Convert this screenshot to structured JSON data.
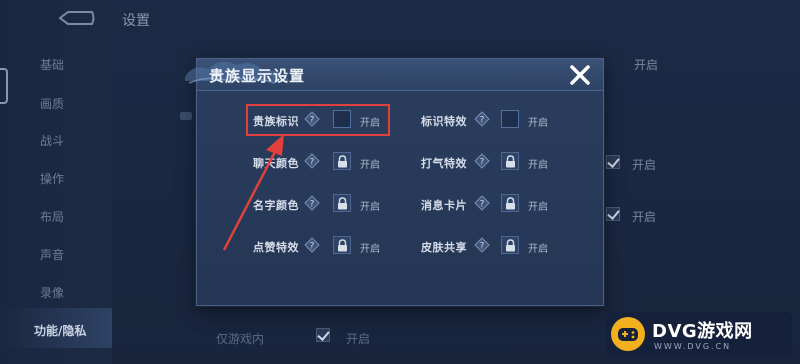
{
  "page": {
    "title": "设置"
  },
  "sidebar": {
    "items": [
      {
        "label": "基础"
      },
      {
        "label": "画质"
      },
      {
        "label": "战斗"
      },
      {
        "label": "操作"
      },
      {
        "label": "布局"
      },
      {
        "label": "声音"
      },
      {
        "label": "录像"
      },
      {
        "label": "功能/隐私"
      }
    ]
  },
  "background": {
    "on_label_1": "开启",
    "on_label_2": "开启",
    "on_label_3": "开启",
    "bottom_text_1": "仅游戏内",
    "bottom_text_2": "开启"
  },
  "modal": {
    "title": "贵族显示设置",
    "left_options": [
      {
        "label": "贵族标识",
        "state": "开启",
        "control": "toggle"
      },
      {
        "label": "聊天颜色",
        "state": "开启",
        "control": "locked"
      },
      {
        "label": "名字颜色",
        "state": "开启",
        "control": "locked"
      },
      {
        "label": "点赞特效",
        "state": "开启",
        "control": "locked"
      }
    ],
    "right_options": [
      {
        "label": "标识特效",
        "state": "开启",
        "control": "toggle"
      },
      {
        "label": "打气特效",
        "state": "开启",
        "control": "locked"
      },
      {
        "label": "消息卡片",
        "state": "开启",
        "control": "locked"
      },
      {
        "label": "皮肤共享",
        "state": "开启",
        "control": "locked"
      }
    ]
  },
  "watermark": {
    "text": "DVG游戏网",
    "url": "WWW.DVG.CN"
  },
  "colors": {
    "highlight": "#e0413d",
    "accent_logo": "#f2b01e"
  }
}
